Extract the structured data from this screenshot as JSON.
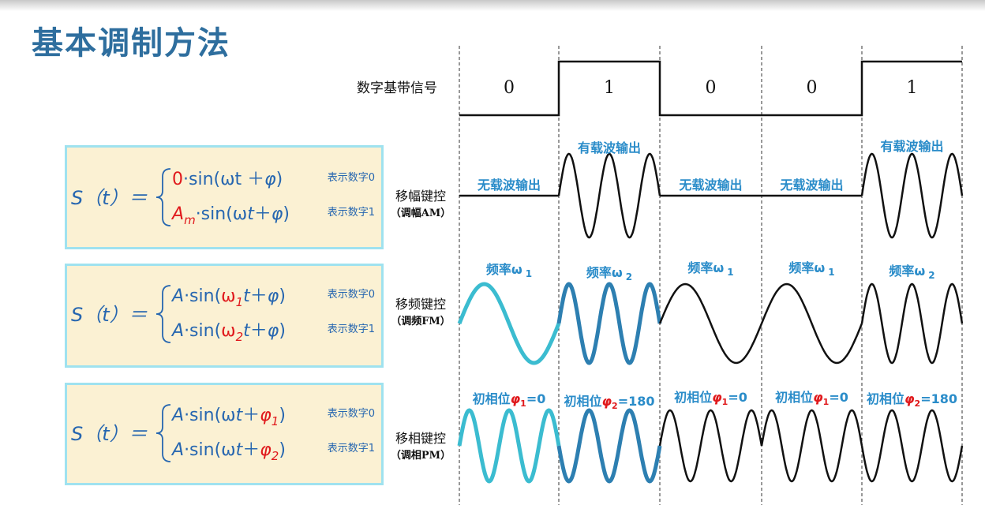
{
  "title": "基本调制方法",
  "signal_label": "数字基带信号",
  "bits": [
    "0",
    "1",
    "0",
    "0",
    "1"
  ],
  "rows": {
    "am": {
      "name": "移幅键控",
      "sub": "（调幅AM）",
      "annotations": [
        "无载波输出",
        "有载波输出",
        "无载波输出",
        "无载波输出",
        "有载波输出"
      ],
      "formula": {
        "lhs": "S（t）＝",
        "line1_parts": [
          "0",
          "·sin(ωt ＋",
          "φ",
          ")"
        ],
        "line2_parts": [
          "A",
          "m",
          "·sin(ω",
          "t",
          "＋",
          "φ",
          ")"
        ],
        "note1": "表示数字0",
        "note2": "表示数字1"
      }
    },
    "fm": {
      "name": "移频键控",
      "sub": "（调频FM）",
      "annotations": [
        {
          "text": "频率ω",
          "sub": "1"
        },
        {
          "text": "频率ω",
          "sub": "2"
        },
        {
          "text": "频率ω",
          "sub": "1"
        },
        {
          "text": "频率ω",
          "sub": "1"
        },
        {
          "text": "频率ω",
          "sub": "2"
        }
      ],
      "formula": {
        "lhs": "S（t）＝",
        "line1_parts": [
          "A",
          "·sin(",
          "ω",
          "1",
          "t",
          "＋",
          "φ",
          ")"
        ],
        "line2_parts": [
          "A",
          "·sin(",
          "ω",
          "2",
          "t",
          "＋",
          "φ",
          ")"
        ],
        "note1": "表示数字0",
        "note2": "表示数字1"
      }
    },
    "pm": {
      "name": "移相键控",
      "sub": "（调相PM）",
      "annotations": [
        {
          "text": "初相位",
          "phi": "φ",
          "sub": "1",
          "value": "=0"
        },
        {
          "text": "初相位",
          "phi": "φ",
          "sub": "2",
          "value": "=180"
        },
        {
          "text": "初相位",
          "phi": "φ",
          "sub": "1",
          "value": "=0"
        },
        {
          "text": "初相位",
          "phi": "φ",
          "sub": "1",
          "value": "=0"
        },
        {
          "text": "初相位",
          "phi": "φ",
          "sub": "2",
          "value": "=180"
        }
      ],
      "formula": {
        "lhs": "S（t）＝",
        "line1_parts": [
          "A",
          "·sin(ω",
          "t",
          "＋",
          "φ",
          "1",
          ")"
        ],
        "line2_parts": [
          "A",
          "·sin(ω",
          "t",
          "＋",
          "φ",
          "2",
          ")"
        ],
        "note1": "表示数字0",
        "note2": "表示数字1"
      }
    }
  },
  "colors": {
    "title": "#2e6e9e",
    "annotation": "#2a8cc9",
    "light_wave": "#3bbcd0",
    "dark_wave": "#2d7fb1",
    "black_wave": "#111111",
    "red": "#e0191c",
    "formula_blue": "#2666b0",
    "box_fill": "#fbf1d3",
    "box_border": "#9fe2ef"
  }
}
